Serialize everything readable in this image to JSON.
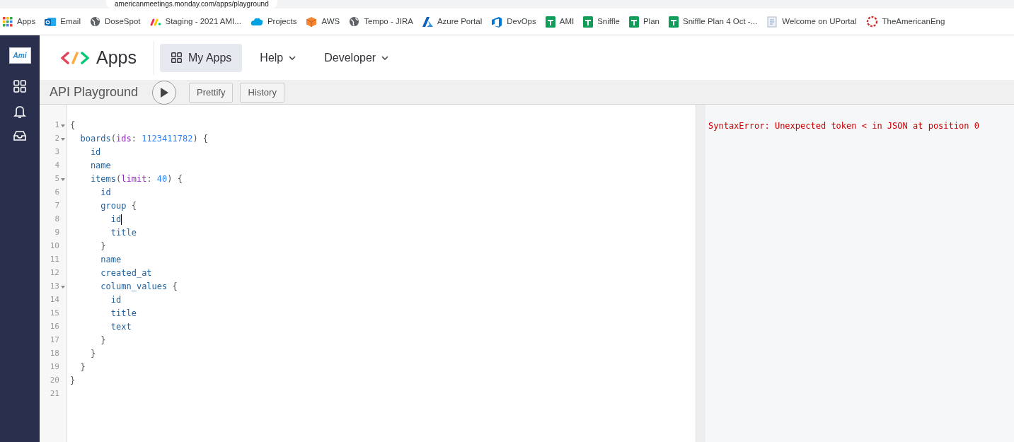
{
  "browser": {
    "url": "americanmeetings.monday.com/apps/playground",
    "bookmarks": [
      {
        "label": "Apps",
        "kind": "grid"
      },
      {
        "label": "Email",
        "kind": "mail"
      },
      {
        "label": "DoseSpot",
        "kind": "globe"
      },
      {
        "label": "Staging - 2021 AMI...",
        "kind": "marks"
      },
      {
        "label": "Projects",
        "kind": "cloud"
      },
      {
        "label": "AWS",
        "kind": "cube"
      },
      {
        "label": "Tempo - JIRA",
        "kind": "globe"
      },
      {
        "label": "Azure Portal",
        "kind": "azure"
      },
      {
        "label": "DevOps",
        "kind": "devops"
      },
      {
        "label": "AMI",
        "kind": "sheet"
      },
      {
        "label": "Sniffle",
        "kind": "sheet"
      },
      {
        "label": "Plan",
        "kind": "sheet"
      },
      {
        "label": "Sniffle Plan 4 Oct -...",
        "kind": "sheet"
      },
      {
        "label": "Welcome on UPortal",
        "kind": "doc"
      },
      {
        "label": "TheAmericanEng",
        "kind": "ring"
      }
    ]
  },
  "sidebar": {
    "logo": "Ami",
    "items": [
      {
        "kind": "grid"
      },
      {
        "kind": "bell"
      },
      {
        "kind": "inbox"
      }
    ]
  },
  "header": {
    "brand": "Apps",
    "nav": [
      {
        "label": "My Apps",
        "selected": true,
        "dropdown": false
      },
      {
        "label": "Help",
        "selected": false,
        "dropdown": true
      },
      {
        "label": "Developer",
        "selected": false,
        "dropdown": true
      }
    ]
  },
  "toolbar": {
    "title": "API Playground",
    "buttons": [
      "Prettify",
      "History"
    ]
  },
  "editor": {
    "lines": [
      {
        "number": "1",
        "foldable": true,
        "tokens": [
          {
            "kind": "punct",
            "text": "{"
          }
        ]
      },
      {
        "number": "2",
        "foldable": true,
        "tokens": [
          {
            "kind": "field",
            "text": "  boards"
          },
          {
            "kind": "punct",
            "text": "("
          },
          {
            "kind": "arg",
            "text": "ids"
          },
          {
            "kind": "punct",
            "text": ": "
          },
          {
            "kind": "number",
            "text": "1123411782"
          },
          {
            "kind": "punct",
            "text": ") {"
          }
        ]
      },
      {
        "number": "3",
        "foldable": false,
        "tokens": [
          {
            "kind": "field",
            "text": "    id"
          }
        ]
      },
      {
        "number": "4",
        "foldable": false,
        "tokens": [
          {
            "kind": "field",
            "text": "    name"
          }
        ]
      },
      {
        "number": "5",
        "foldable": true,
        "tokens": [
          {
            "kind": "field",
            "text": "    items"
          },
          {
            "kind": "punct",
            "text": "("
          },
          {
            "kind": "arg",
            "text": "limit"
          },
          {
            "kind": "punct",
            "text": ": "
          },
          {
            "kind": "number",
            "text": "40"
          },
          {
            "kind": "punct",
            "text": ") {"
          }
        ]
      },
      {
        "number": "6",
        "foldable": false,
        "tokens": [
          {
            "kind": "field",
            "text": "      id"
          }
        ]
      },
      {
        "number": "7",
        "foldable": false,
        "tokens": [
          {
            "kind": "field",
            "text": "      group"
          },
          {
            "kind": "punct",
            "text": " {"
          }
        ]
      },
      {
        "number": "8",
        "foldable": false,
        "cursor": true,
        "tokens": [
          {
            "kind": "field",
            "text": "        id"
          }
        ]
      },
      {
        "number": "9",
        "foldable": false,
        "tokens": [
          {
            "kind": "field",
            "text": "        title"
          }
        ]
      },
      {
        "number": "10",
        "foldable": false,
        "tokens": [
          {
            "kind": "punct",
            "text": "      }"
          }
        ]
      },
      {
        "number": "11",
        "foldable": false,
        "tokens": [
          {
            "kind": "field",
            "text": "      name"
          }
        ]
      },
      {
        "number": "12",
        "foldable": false,
        "tokens": [
          {
            "kind": "field",
            "text": "      created_at"
          }
        ]
      },
      {
        "number": "13",
        "foldable": true,
        "tokens": [
          {
            "kind": "field",
            "text": "      column_values"
          },
          {
            "kind": "punct",
            "text": " {"
          }
        ]
      },
      {
        "number": "14",
        "foldable": false,
        "tokens": [
          {
            "kind": "field",
            "text": "        id"
          }
        ]
      },
      {
        "number": "15",
        "foldable": false,
        "tokens": [
          {
            "kind": "field",
            "text": "        title"
          }
        ]
      },
      {
        "number": "16",
        "foldable": false,
        "tokens": [
          {
            "kind": "field",
            "text": "        text"
          }
        ]
      },
      {
        "number": "17",
        "foldable": false,
        "tokens": [
          {
            "kind": "punct",
            "text": "      }"
          }
        ]
      },
      {
        "number": "18",
        "foldable": false,
        "tokens": [
          {
            "kind": "punct",
            "text": "    }"
          }
        ]
      },
      {
        "number": "19",
        "foldable": false,
        "tokens": [
          {
            "kind": "punct",
            "text": "  }"
          }
        ]
      },
      {
        "number": "20",
        "foldable": false,
        "tokens": [
          {
            "kind": "punct",
            "text": "}"
          }
        ]
      },
      {
        "number": "21",
        "foldable": false
      }
    ]
  },
  "result": {
    "error": "SyntaxError: Unexpected token < in JSON at position 0"
  }
}
